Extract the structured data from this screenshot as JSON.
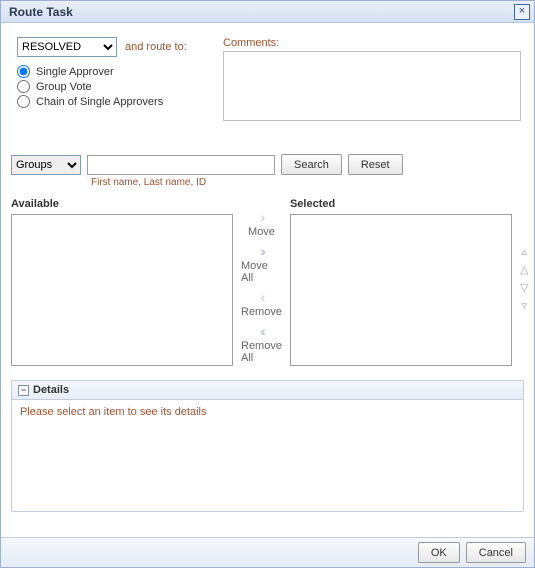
{
  "dialog": {
    "title": "Route Task",
    "close_icon": "×"
  },
  "status": {
    "selected": "RESOLVED",
    "and_route_to": "and route to:"
  },
  "route_options": {
    "single_approver": "Single Approver",
    "group_vote": "Group Vote",
    "chain": "Chain of Single Approvers"
  },
  "comments": {
    "label": "Comments:",
    "value": ""
  },
  "search": {
    "scope_selected": "Groups",
    "input_value": "",
    "search_btn": "Search",
    "reset_btn": "Reset",
    "hint": "First name, Last name, ID"
  },
  "shuttle": {
    "available_label": "Available",
    "selected_label": "Selected",
    "move": "Move",
    "move_all": "Move All",
    "remove": "Remove",
    "remove_all": "Remove All"
  },
  "details": {
    "header": "Details",
    "body": "Please select an item to see its details"
  },
  "footer": {
    "ok": "OK",
    "cancel": "Cancel"
  }
}
